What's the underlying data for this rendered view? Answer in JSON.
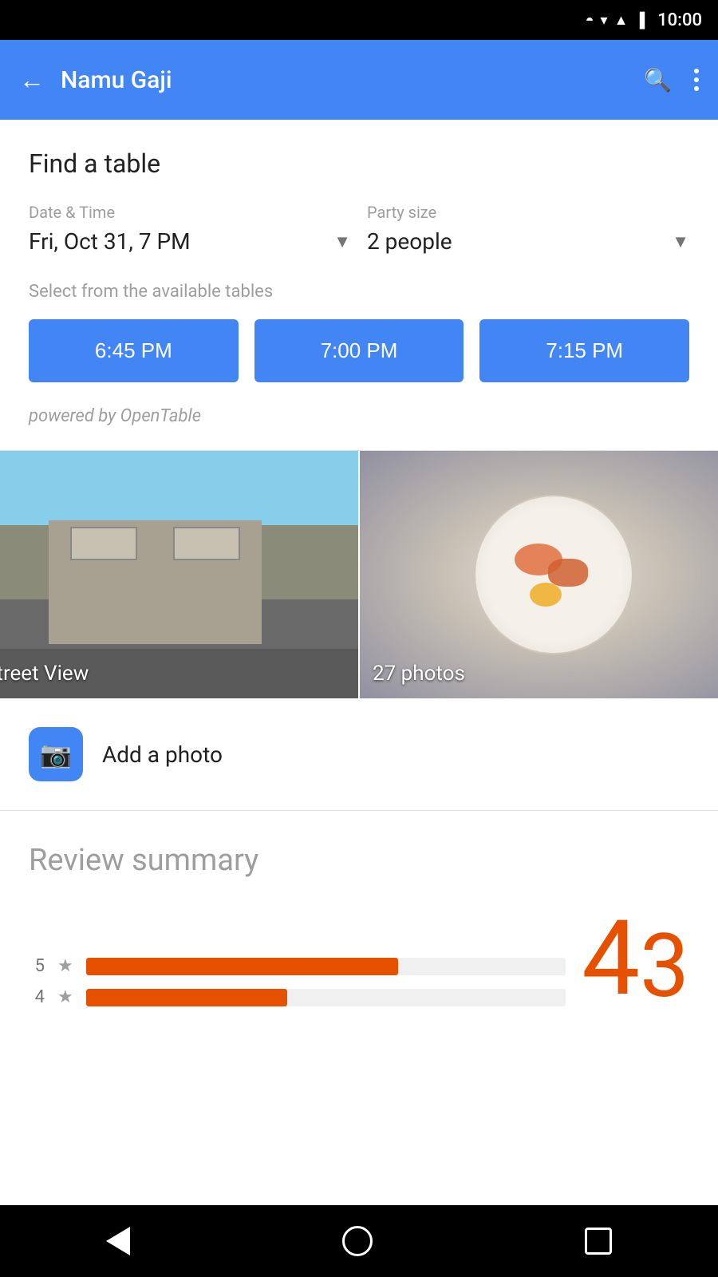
{
  "statusBar": {
    "time": "10:00"
  },
  "appBar": {
    "title": "Namu Gaji",
    "backLabel": "←",
    "searchLabel": "search",
    "moreLabel": "more"
  },
  "findTable": {
    "title": "Find a table",
    "dateTimeLabel": "Date & Time",
    "dateTimeValue": "Fri, Oct 31, 7 PM",
    "partySizeLabel": "Party size",
    "partySizeValue": "2 people",
    "availableLabel": "Select from the available tables",
    "timeSlots": [
      "6:45 PM",
      "7:00 PM",
      "7:15 PM"
    ],
    "poweredBy": "powered by OpenTable"
  },
  "photos": {
    "streetViewLabel": "Street View",
    "photosLabel": "27 photos",
    "addPhotoLabel": "Add a photo"
  },
  "reviewSummary": {
    "title": "Review summary",
    "bigRating1": "4",
    "bigRating2": "3",
    "bars": [
      {
        "num": "5",
        "width": "65"
      },
      {
        "num": "4",
        "width": "42"
      }
    ]
  },
  "bottomNav": {
    "backLabel": "back",
    "homeLabel": "home",
    "recentsLabel": "recents"
  }
}
